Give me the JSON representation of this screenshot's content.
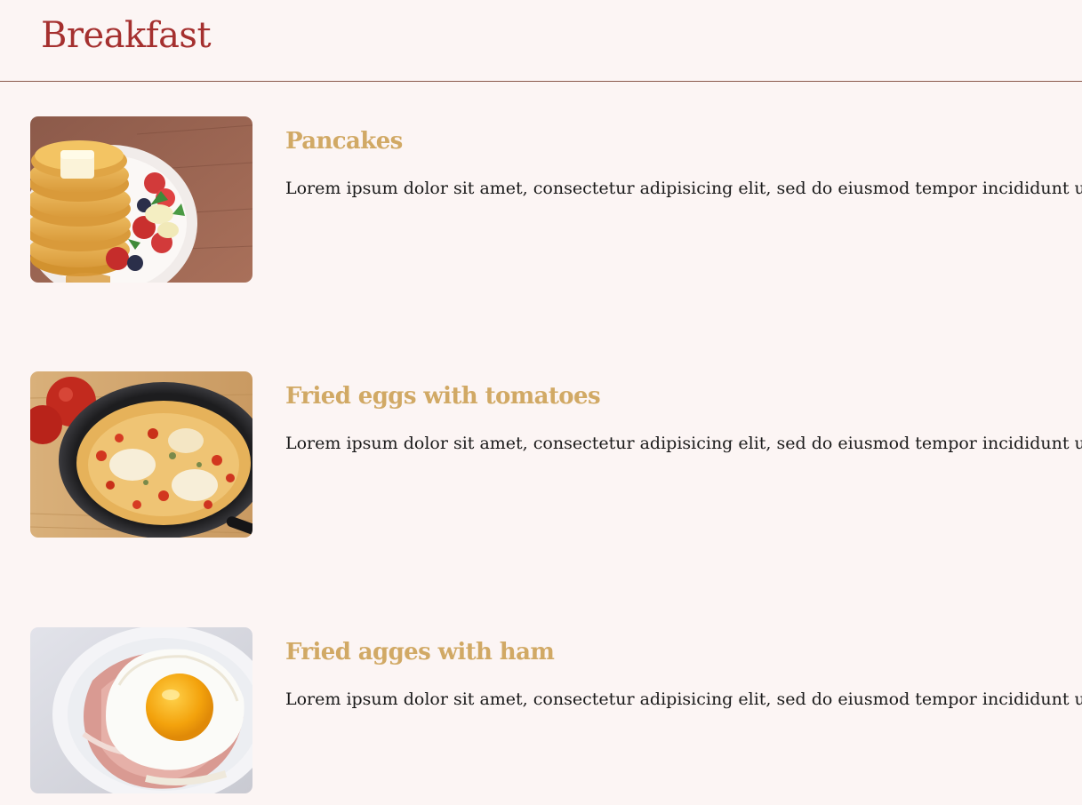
{
  "header": {
    "title": "Breakfast"
  },
  "items": [
    {
      "title": "Pancakes",
      "description": "Lorem ipsum dolor sit amet, consectetur adipisicing elit, sed do eiusmod tempor incididunt ut labore et dolore magna aliqua.",
      "image": "pancakes-photo"
    },
    {
      "title": "Fried eggs with tomatoes",
      "description": "Lorem ipsum dolor sit amet, consectetur adipisicing elit, sed do eiusmod tempor incididunt ut labore et dolore magna aliqua.",
      "image": "fried-eggs-tomatoes-photo"
    },
    {
      "title": "Fried agges with ham",
      "description": "Lorem ipsum dolor sit amet, consectetur adipisicing elit, sed do eiusmod tempor incididunt ut labore et dolore magna aliqua.",
      "image": "fried-egg-ham-photo"
    }
  ],
  "colors": {
    "background": "#fcf5f4",
    "title": "#a5302f",
    "item_title": "#d1a965",
    "text": "#1a1a1a",
    "divider": "#8a5a4c"
  }
}
